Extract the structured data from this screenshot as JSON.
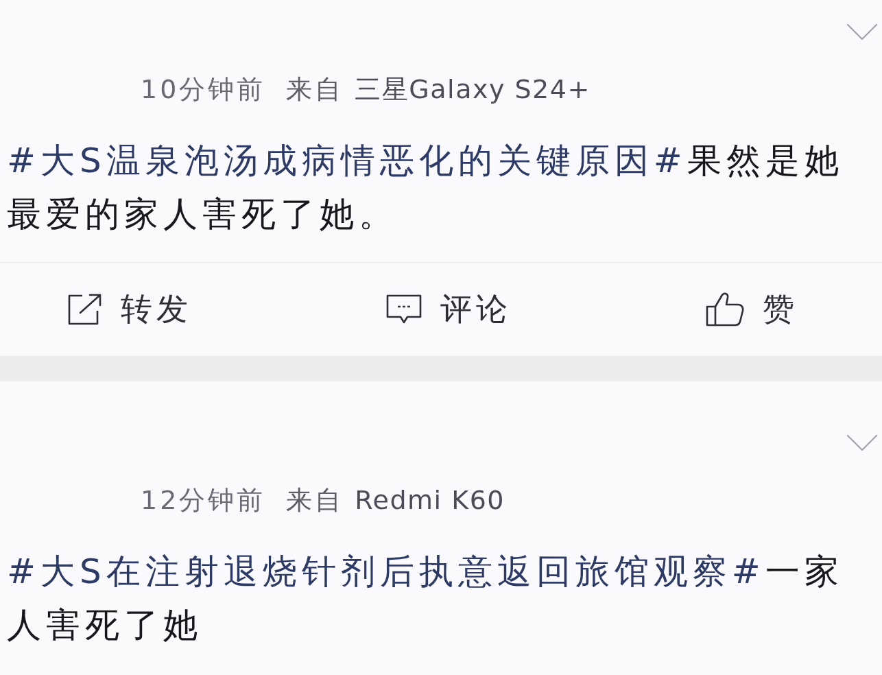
{
  "posts": [
    {
      "time": "10分钟前",
      "source": "来自",
      "device": "三星Galaxy S24+",
      "hashtag": "#大S温泉泡汤成病情恶化的关键原因#",
      "text": "果然是她最爱的家人害死了她。",
      "actions": [
        {
          "kind": "repost",
          "label": "转发"
        },
        {
          "kind": "comment",
          "label": "评论"
        },
        {
          "kind": "like",
          "label": "赞"
        }
      ]
    },
    {
      "time": "12分钟前",
      "source": "来自",
      "device": "Redmi K60",
      "hashtag": "#大S在注射退烧针剂后执意返回旅馆观察#",
      "text": "一家人害死了她"
    }
  ]
}
